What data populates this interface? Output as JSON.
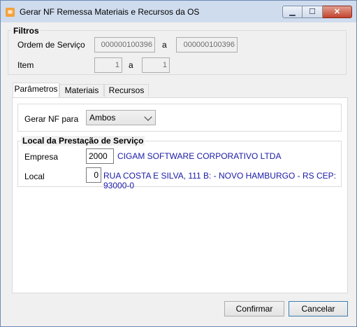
{
  "window": {
    "title": "Gerar NF Remessa Materiais e Recursos da OS",
    "app_icon": "app-logo-icon"
  },
  "filters": {
    "title": "Filtros",
    "ordem_label": "Ordem de Serviço",
    "ordem_from": "000000100396",
    "ordem_to": "000000100396",
    "sep_a": "a",
    "item_label": "Item",
    "item_from": "1",
    "item_to": "1",
    "sep_a2": "a"
  },
  "tabs": [
    {
      "label": "Parâmetros",
      "selected": true
    },
    {
      "label": "Materiais",
      "selected": false
    },
    {
      "label": "Recursos",
      "selected": false
    }
  ],
  "params": {
    "gerar_label": "Gerar NF para",
    "gerar_value": "Ambos"
  },
  "local": {
    "title": "Local da Prestação de Serviço",
    "empresa_label": "Empresa",
    "empresa_value": "2000",
    "empresa_name": "CIGAM SOFTWARE CORPORATIVO LTDA",
    "local_label": "Local",
    "local_value": "0",
    "local_address": "RUA COSTA E SILVA, 111 B:  - NOVO HAMBURGO - RS CEP: 93000-0"
  },
  "buttons": {
    "confirm": "Confirmar",
    "cancel": "Cancelar"
  }
}
